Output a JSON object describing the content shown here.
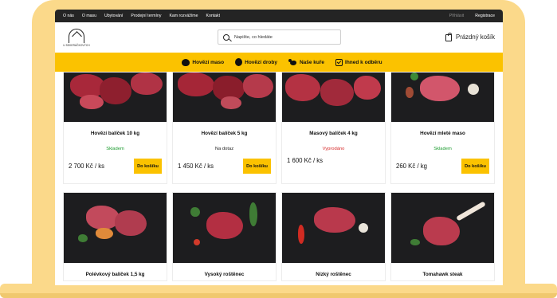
{
  "topbar": {
    "links": [
      "O nás",
      "O masu",
      "Ubytování",
      "Prodejní termíny",
      "Kam rozvážíme",
      "Kontakt"
    ],
    "login": "Přihlásit",
    "register": "Registrace"
  },
  "header": {
    "logo_text": "U SEKERÁČKOVÝCH",
    "search_placeholder": "Napište, co hledáte",
    "cart_label": "Prázdný košík"
  },
  "categories": [
    {
      "label": "Hovězí maso",
      "icon": "cow-icon"
    },
    {
      "label": "Hovězí droby",
      "icon": "organ-icon"
    },
    {
      "label": "Naše kuře",
      "icon": "chicken-icon"
    },
    {
      "label": "Ihned k odběru",
      "icon": "ready-check-icon"
    }
  ],
  "products_row1": [
    {
      "title": "Hovězí balíček 10 kg",
      "status": "Skladem",
      "status_color": "#1a9b2e",
      "price": "2 700 Kč / ks",
      "button": "Do košíku"
    },
    {
      "title": "Hovězí balíček 5 kg",
      "status": "Na dotaz",
      "status_color": "#222222",
      "price": "1 450 Kč / ks",
      "button": "Do košíku"
    },
    {
      "title": "Masový balíček 4 kg",
      "status": "Vyprodáno",
      "status_color": "#d62a2a",
      "price": "1 600 Kč / ks",
      "button": ""
    },
    {
      "title": "Hovězí mleté maso",
      "status": "Skladem",
      "status_color": "#1a9b2e",
      "price": "260 Kč / kg",
      "button": "Do košíku"
    }
  ],
  "products_row2": [
    {
      "title": "Polévkový balíček 1,5 kg"
    },
    {
      "title": "Vysoký roštěnec"
    },
    {
      "title": "Nízký roštěnec"
    },
    {
      "title": "Tomahawk steak"
    }
  ],
  "colors": {
    "accent": "#fbc200",
    "frame": "#fbd98a",
    "topbar": "#242424"
  }
}
